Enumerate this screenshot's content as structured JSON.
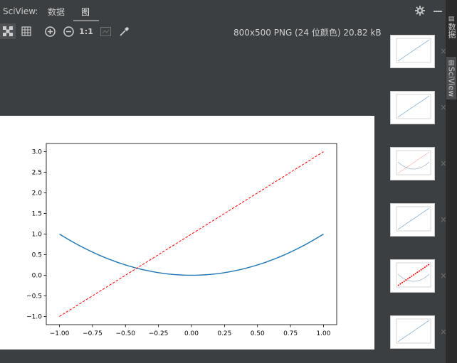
{
  "header": {
    "title": "SciView:",
    "tabs": [
      {
        "label": "数据",
        "active": false
      },
      {
        "label": "图",
        "active": true
      }
    ]
  },
  "toolbar": {
    "zoom_label": "1:1",
    "image_info": "800x500 PNG (24 位颜色) 20.82 kB",
    "buttons": [
      "chessboard-icon",
      "grid-icon",
      "zoom-in-icon",
      "zoom-out-icon",
      "actual-size",
      "fit-icon",
      "color-picker-icon"
    ]
  },
  "side_tabs": [
    {
      "label": "数据"
    },
    {
      "label": "SciView",
      "active": true
    }
  ],
  "thumbnails_count": 6,
  "thumb_close_glyph": "×",
  "chart_data": {
    "type": "line",
    "x_ticks": [
      "−1.00",
      "−0.75",
      "−0.50",
      "−0.25",
      "0.00",
      "0.25",
      "0.50",
      "0.75",
      "1.00"
    ],
    "y_ticks": [
      "−1.0",
      "−0.5",
      "0.0",
      "0.5",
      "1.0",
      "1.5",
      "2.0",
      "2.5",
      "3.0"
    ],
    "xlim": [
      -1.1,
      1.1
    ],
    "ylim": [
      -1.2,
      3.2
    ],
    "series": [
      {
        "style": "solid",
        "color": "#1f77b4",
        "function": "y = x^2",
        "x": [
          -1,
          -0.75,
          -0.5,
          -0.25,
          0,
          0.25,
          0.5,
          0.75,
          1
        ],
        "y": [
          1,
          0.5625,
          0.25,
          0.0625,
          0,
          0.0625,
          0.25,
          0.5625,
          1
        ]
      },
      {
        "style": "dashed",
        "color": "#ff0000",
        "function": "y = 2x + 1",
        "x": [
          -1,
          1
        ],
        "y": [
          -1,
          3
        ]
      }
    ]
  },
  "colors": {
    "bg": "#3c3f41",
    "canvas": "#ffffff",
    "side_bar": "#2b2b2b"
  }
}
